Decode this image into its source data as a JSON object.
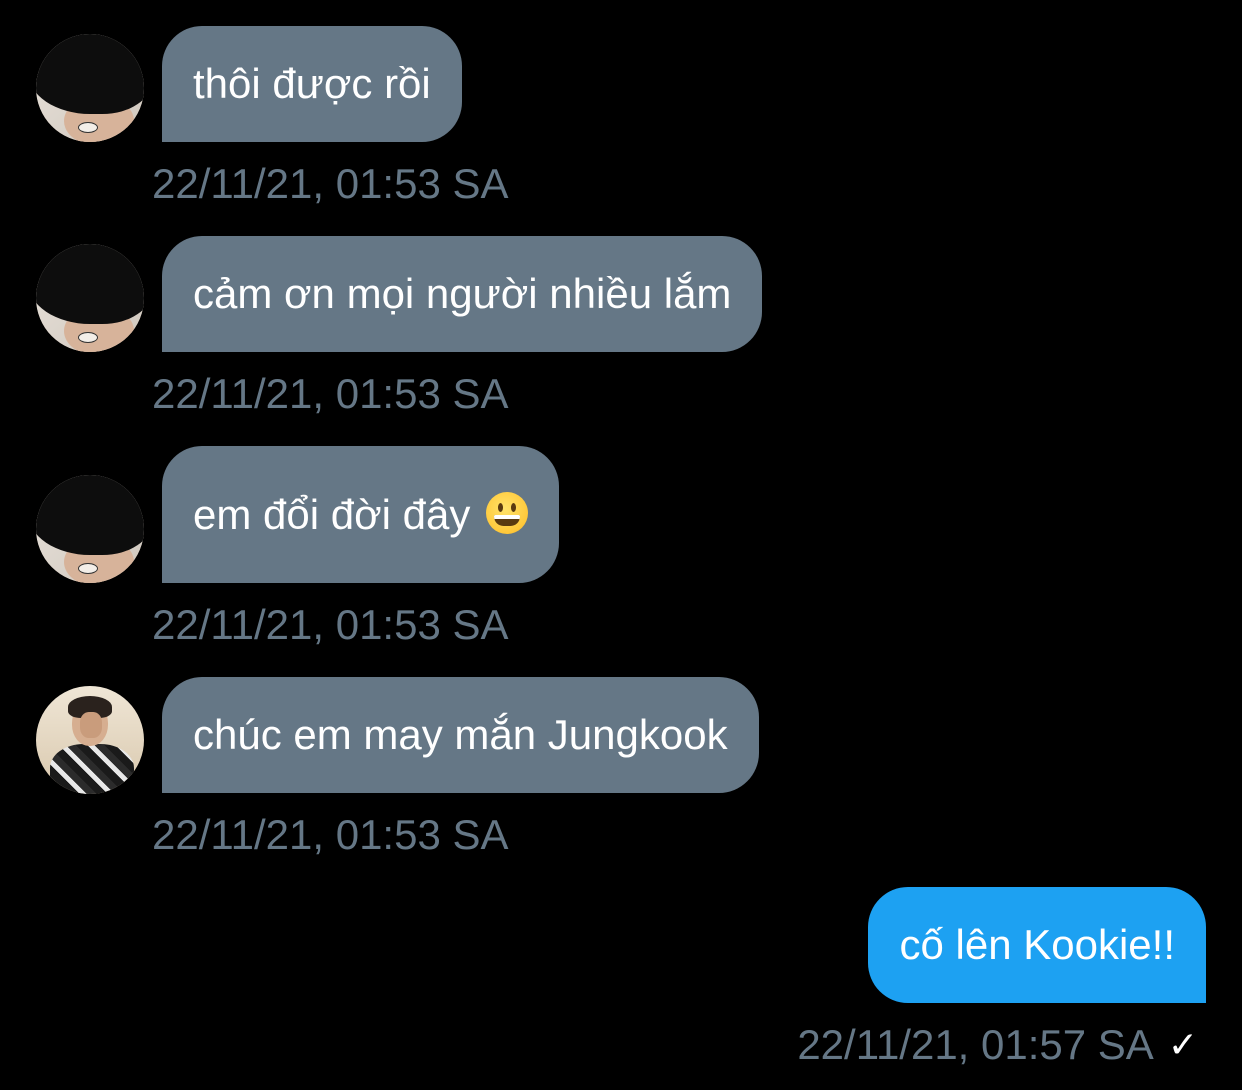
{
  "conversation": {
    "messages": [
      {
        "direction": "received",
        "avatar_icon": "avatar-jungkook",
        "text": "thôi được rồi",
        "emoji": "",
        "timestamp": "22/11/21, 01:53 SA"
      },
      {
        "direction": "received",
        "avatar_icon": "avatar-jungkook",
        "text": "cảm ơn mọi người nhiều lắm",
        "emoji": "",
        "timestamp": "22/11/21, 01:53 SA"
      },
      {
        "direction": "received",
        "avatar_icon": "avatar-jungkook",
        "text": "em đổi đời đây",
        "emoji": "grinning-face",
        "timestamp": "22/11/21, 01:53 SA"
      },
      {
        "direction": "received",
        "avatar_icon": "avatar-other-user",
        "text": "chúc em may mắn Jungkook",
        "emoji": "",
        "timestamp": "22/11/21, 01:53 SA"
      },
      {
        "direction": "sent",
        "text": "cố lên Kookie!!",
        "timestamp": "22/11/21, 01:57 SA",
        "status_icon": "checkmark-icon",
        "status_glyph": "✓"
      }
    ]
  },
  "colors": {
    "background": "#000000",
    "received_bubble": "#657786",
    "sent_bubble": "#1da1f2",
    "timestamp_text": "#657786",
    "bubble_text": "#ffffff"
  }
}
